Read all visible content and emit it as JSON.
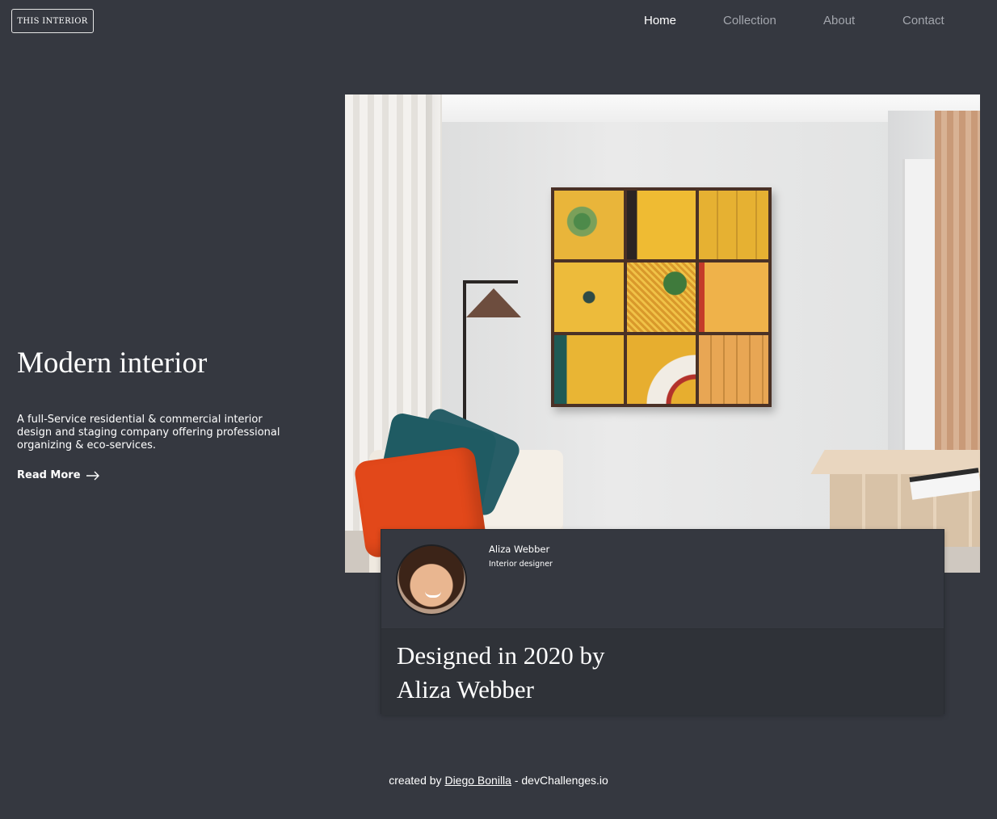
{
  "header": {
    "logo_text": "THIS INTERIOR",
    "nav": [
      {
        "label": "Home",
        "active": true
      },
      {
        "label": "Collection",
        "active": false
      },
      {
        "label": "About",
        "active": false
      },
      {
        "label": "Contact",
        "active": false
      }
    ]
  },
  "hero": {
    "title": "Modern interior",
    "description": "A full-Service residential & commercial interior design and staging company offering professional organizing & eco-services.",
    "read_more_label": "Read More",
    "read_more_icon": "arrow-right-icon"
  },
  "designer_card": {
    "name": "Aliza Webber",
    "role": "Interior designer",
    "headline": "Designed in 2020 by Aliza Webber"
  },
  "footer": {
    "prefix": "created by",
    "author": "Diego Bonilla",
    "suffix": "- devChallenges.io"
  },
  "colors": {
    "background": "#353840",
    "card_bottom": "#2f3238",
    "nav_inactive": "#a3a6ad",
    "text": "#ffffff"
  }
}
